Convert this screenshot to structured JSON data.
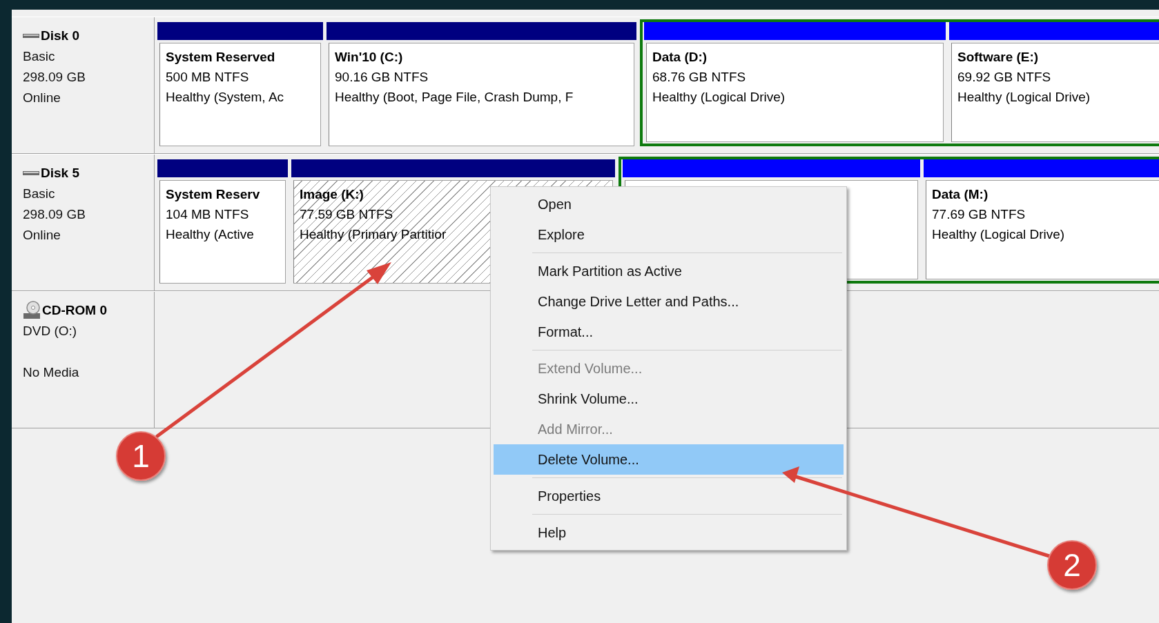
{
  "disks": [
    {
      "name": "Disk 0",
      "kind": "disk",
      "lines": [
        "Basic",
        "298.09 GB",
        "Online"
      ],
      "partitions": [
        {
          "kind": "primary",
          "selected": false,
          "title": "System Reserved",
          "size": "500 MB NTFS",
          "status": "Healthy (System, Ac"
        },
        {
          "kind": "primary",
          "selected": false,
          "title": "Win'10  (C:)",
          "size": "90.16 GB NTFS",
          "status": "Healthy (Boot, Page File, Crash Dump, F"
        },
        {
          "kind": "logical",
          "selected": false,
          "title": "Data  (D:)",
          "size": "68.76 GB NTFS",
          "status": "Healthy (Logical Drive)"
        },
        {
          "kind": "logical",
          "selected": false,
          "title": "Software  (E:)",
          "size": "69.92 GB NTFS",
          "status": "Healthy (Logical Drive)"
        }
      ]
    },
    {
      "name": "Disk 5",
      "kind": "disk",
      "lines": [
        "Basic",
        "298.09 GB",
        "Online"
      ],
      "partitions": [
        {
          "kind": "primary",
          "selected": false,
          "title": "System Reserv",
          "size": "104 MB NTFS",
          "status": "Healthy (Active"
        },
        {
          "kind": "primary",
          "selected": true,
          "title": "Image  (K:)",
          "size": "77.59 GB NTFS",
          "status": "Healthy (Primary Partitior"
        },
        {
          "kind": "logical",
          "selected": false
        },
        {
          "kind": "logical",
          "selected": false,
          "title": "Data  (M:)",
          "size": "77.69 GB NTFS",
          "status": "Healthy (Logical Drive)"
        }
      ]
    },
    {
      "name": "CD-ROM 0",
      "kind": "cdrom",
      "lines": [
        "DVD (O:)",
        "No Media"
      ]
    }
  ],
  "context_menu": {
    "groups": [
      {
        "items": [
          {
            "label": "Open",
            "disabled": false,
            "highlighted": false
          },
          {
            "label": "Explore",
            "disabled": false,
            "highlighted": false
          }
        ]
      },
      {
        "items": [
          {
            "label": "Mark Partition as Active",
            "disabled": false,
            "highlighted": false
          },
          {
            "label": "Change Drive Letter and Paths...",
            "disabled": false,
            "highlighted": false
          },
          {
            "label": "Format...",
            "disabled": false,
            "highlighted": false
          }
        ]
      },
      {
        "items": [
          {
            "label": "Extend Volume...",
            "disabled": true,
            "highlighted": false
          },
          {
            "label": "Shrink Volume...",
            "disabled": false,
            "highlighted": false
          },
          {
            "label": "Add Mirror...",
            "disabled": true,
            "highlighted": false
          },
          {
            "label": "Delete Volume...",
            "disabled": false,
            "highlighted": true
          }
        ]
      },
      {
        "items": [
          {
            "label": "Properties",
            "disabled": false,
            "highlighted": false
          }
        ]
      },
      {
        "items": [
          {
            "label": "Help",
            "disabled": false,
            "highlighted": false
          }
        ]
      }
    ]
  },
  "annotations": [
    {
      "label": "1"
    },
    {
      "label": "2"
    }
  ]
}
